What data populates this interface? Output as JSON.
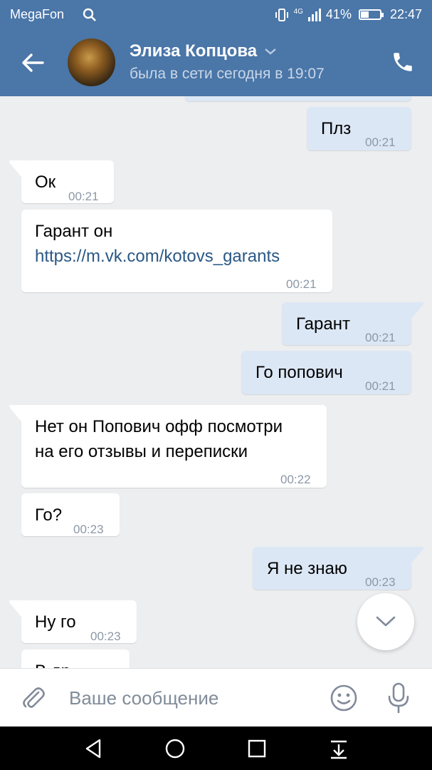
{
  "statusbar": {
    "carrier": "MegaFon",
    "network": "4G",
    "battery_text": "41%",
    "battery_level": 0.41,
    "time": "22:47"
  },
  "header": {
    "name": "Элиза Копцова",
    "status": "была в сети сегодня в 19:07"
  },
  "messages": [
    {
      "dir": "out",
      "text": "Плз",
      "time": "00:21"
    },
    {
      "dir": "in",
      "text": "Ок",
      "time": "00:21"
    },
    {
      "dir": "in",
      "text": "Гарант он",
      "link": "https://m.vk.com/kotovs_garants",
      "time": "00:21"
    },
    {
      "dir": "out",
      "text": "Гарант",
      "time": "00:21"
    },
    {
      "dir": "out",
      "text": "Го попович",
      "time": "00:21"
    },
    {
      "dir": "in",
      "text": "Нет он Попович офф посмотри",
      "text2": "на его отзывы и переписки",
      "time": "00:22"
    },
    {
      "dir": "in",
      "text": "Го?",
      "time": "00:23"
    },
    {
      "dir": "out",
      "text": "Я не знаю",
      "time": "00:23"
    },
    {
      "dir": "in",
      "text": "Ну го",
      "time": "00:23"
    },
    {
      "dir": "in",
      "text": "В др"
    }
  ],
  "input": {
    "placeholder": "Ваше сообщение"
  },
  "colors": {
    "header_bg": "#4a76a8",
    "chat_bg": "#edeef0",
    "bubble_in": "#ffffff",
    "bubble_out": "#dce7f5",
    "link": "#2a5885"
  },
  "icons": [
    "search-icon",
    "back-arrow-icon",
    "chevron-down-icon",
    "phone-icon",
    "attach-icon",
    "emoji-icon",
    "mic-icon",
    "nav-back-icon",
    "nav-home-icon",
    "nav-recents-icon",
    "nav-notifications-icon",
    "scroll-down-icon"
  ]
}
